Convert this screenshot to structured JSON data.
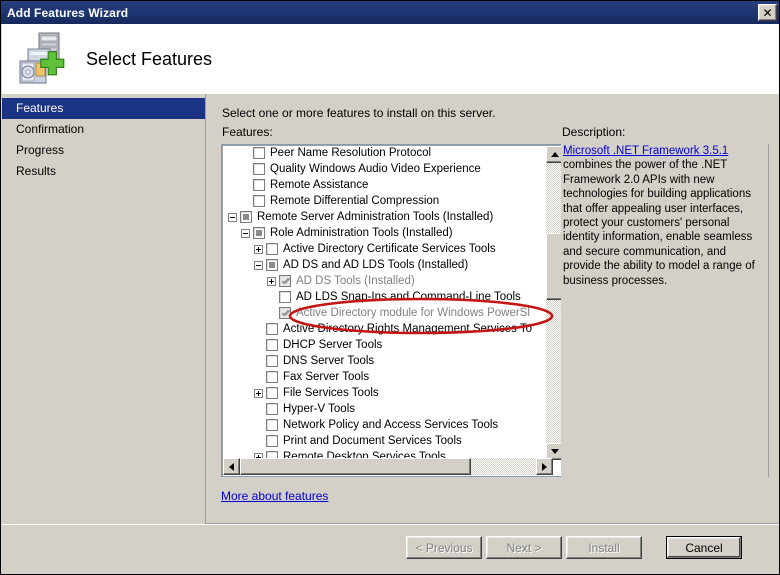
{
  "window": {
    "title": "Add Features Wizard",
    "close_label": "✕"
  },
  "banner": {
    "heading": "Select Features",
    "icon": "server-add-icon"
  },
  "sidebar": {
    "items": [
      {
        "label": "Features",
        "selected": true
      },
      {
        "label": "Confirmation",
        "selected": false
      },
      {
        "label": "Progress",
        "selected": false
      },
      {
        "label": "Results",
        "selected": false
      }
    ]
  },
  "main": {
    "instruction": "Select one or more features to install on this server.",
    "features_label": "Features:",
    "description_label": "Description:",
    "more_link": "More about features"
  },
  "tree": {
    "rows": [
      {
        "indent": 1,
        "expander": "none",
        "checkbox": "empty",
        "label": "Peer Name Resolution Protocol",
        "dim": false
      },
      {
        "indent": 1,
        "expander": "none",
        "checkbox": "empty",
        "label": "Quality Windows Audio Video Experience",
        "dim": false
      },
      {
        "indent": 1,
        "expander": "none",
        "checkbox": "empty",
        "label": "Remote Assistance",
        "dim": false
      },
      {
        "indent": 1,
        "expander": "none",
        "checkbox": "empty",
        "label": "Remote Differential Compression",
        "dim": false
      },
      {
        "indent": 0,
        "expander": "minus",
        "checkbox": "partial",
        "label": "Remote Server Administration Tools  (Installed)",
        "dim": false
      },
      {
        "indent": 1,
        "expander": "minus",
        "checkbox": "partial",
        "label": "Role Administration Tools  (Installed)",
        "dim": false
      },
      {
        "indent": 2,
        "expander": "plus",
        "checkbox": "empty",
        "label": "Active Directory Certificate Services Tools",
        "dim": false
      },
      {
        "indent": 2,
        "expander": "minus",
        "checkbox": "partial",
        "label": "AD DS and AD LDS Tools  (Installed)",
        "dim": false
      },
      {
        "indent": 3,
        "expander": "plus",
        "checkbox": "checkedgray",
        "label": "AD DS Tools  (Installed)",
        "dim": true
      },
      {
        "indent": 3,
        "expander": "none",
        "checkbox": "empty",
        "label": "AD LDS Snap-Ins and Command-Line Tools",
        "dim": false
      },
      {
        "indent": 3,
        "expander": "none",
        "checkbox": "checkedgray",
        "label": "Active Directory module for Windows PowerSl",
        "dim": true
      },
      {
        "indent": 2,
        "expander": "none",
        "checkbox": "empty",
        "label": "Active Directory Rights Management Services To",
        "dim": false
      },
      {
        "indent": 2,
        "expander": "none",
        "checkbox": "empty",
        "label": "DHCP Server Tools",
        "dim": false
      },
      {
        "indent": 2,
        "expander": "none",
        "checkbox": "empty",
        "label": "DNS Server Tools",
        "dim": false
      },
      {
        "indent": 2,
        "expander": "none",
        "checkbox": "empty",
        "label": "Fax Server Tools",
        "dim": false
      },
      {
        "indent": 2,
        "expander": "plus",
        "checkbox": "empty",
        "label": "File Services Tools",
        "dim": false
      },
      {
        "indent": 2,
        "expander": "none",
        "checkbox": "empty",
        "label": "Hyper-V Tools",
        "dim": false
      },
      {
        "indent": 2,
        "expander": "none",
        "checkbox": "empty",
        "label": "Network Policy and Access Services Tools",
        "dim": false
      },
      {
        "indent": 2,
        "expander": "none",
        "checkbox": "empty",
        "label": "Print and Document Services Tools",
        "dim": false
      },
      {
        "indent": 2,
        "expander": "plus",
        "checkbox": "empty",
        "label": "Remote Desktop Services Tools",
        "dim": false
      }
    ]
  },
  "description": {
    "link_text": "Microsoft .NET Framework 3.5.1",
    "body": " combines the power of the .NET Framework 2.0 APIs with new technologies for building applications that offer appealing user interfaces, protect your customers' personal identity information, enable seamless and secure communication, and provide the ability to model a range of business processes."
  },
  "footer": {
    "buttons": [
      {
        "label": "< Previous",
        "disabled": true,
        "default": false
      },
      {
        "label": "Next >",
        "disabled": true,
        "default": false
      },
      {
        "label": "Install",
        "disabled": true,
        "default": false
      },
      {
        "label": "Cancel",
        "disabled": false,
        "default": true
      }
    ]
  },
  "annotation": {
    "shape": "ellipse",
    "color": "#cc1111",
    "target": "Active Directory module for Windows PowerShell"
  },
  "colors": {
    "titlebar": "#1d3572",
    "nav_selected": "#1a3384",
    "dialog_bg": "#d4d0c8",
    "link": "#0000d4",
    "annotation_red": "#cc1111"
  }
}
